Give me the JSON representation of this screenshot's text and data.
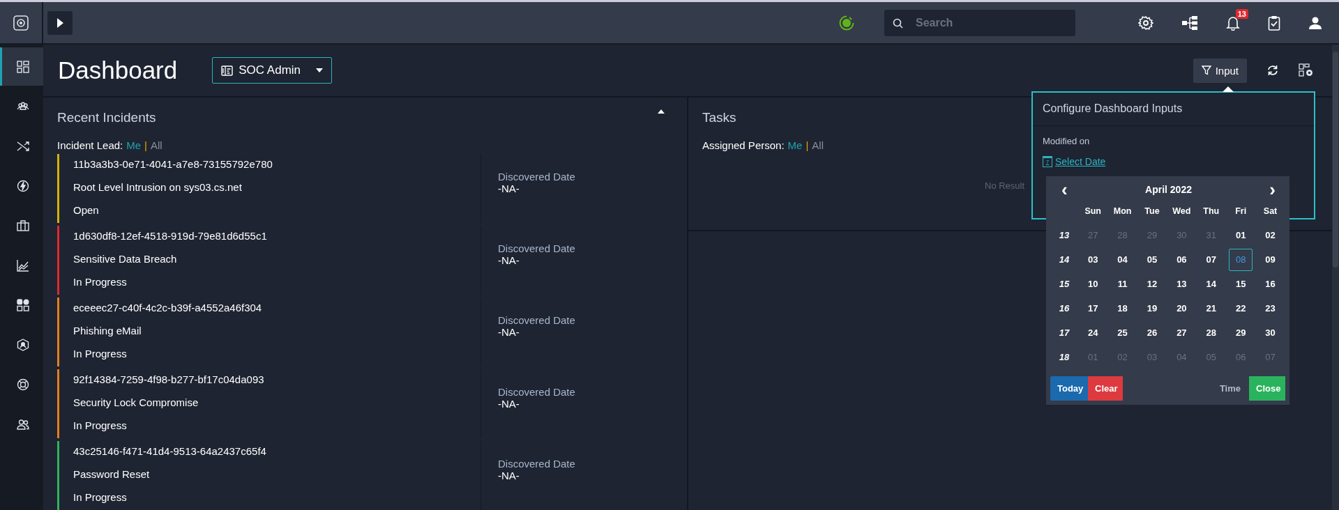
{
  "top_bar": {
    "search": {
      "placeholder": "Search"
    },
    "notifications": {
      "count": "13"
    }
  },
  "sidebar": {
    "items": [
      {
        "selected": true
      },
      {
        "selected": false
      },
      {
        "selected": false
      },
      {
        "selected": false
      },
      {
        "selected": false
      },
      {
        "selected": false
      },
      {
        "selected": false
      },
      {
        "selected": false
      },
      {
        "selected": false
      },
      {
        "selected": false
      }
    ]
  },
  "header": {
    "title": "Dashboard",
    "dashboard_select": "SOC Admin",
    "input_button": "Input"
  },
  "recent_incidents": {
    "title": "Recent Incidents",
    "filter": {
      "label": "Incident Lead:",
      "options": [
        {
          "label": "Me",
          "selected": true
        },
        {
          "label": "All",
          "selected": false
        }
      ],
      "separator": "|"
    },
    "rows": [
      {
        "id": "11b3a3b3-0e71-4041-a7e8-73155792e780",
        "name": "Root Level Intrusion on sys03.cs.net",
        "status": "Open",
        "color": "#d4b106",
        "date_label": "Discovered Date",
        "date": "-NA-"
      },
      {
        "id": "1d630df8-12ef-4518-919d-79e81d6d55c1",
        "name": "Sensitive Data Breach",
        "status": "In Progress",
        "color": "#e0282e",
        "date_label": "Discovered Date",
        "date": "-NA-"
      },
      {
        "id": "eceeec27-c40f-4c2c-b39f-a4552a46f304",
        "name": "Phishing eMail",
        "status": "In Progress",
        "color": "#e57f19",
        "date_label": "Discovered Date",
        "date": "-NA-"
      },
      {
        "id": "92f14384-7259-4f98-b277-bf17c04da093",
        "name": "Security Lock Compromise",
        "status": "In Progress",
        "color": "#e57f19",
        "date_label": "Discovered Date",
        "date": "-NA-"
      },
      {
        "id": "43c25146-f471-41d4-9513-64a2437c65f4",
        "name": "Password Reset",
        "status": "In Progress",
        "color": "#2fb35a",
        "date_label": "Discovered Date",
        "date": "-NA-"
      }
    ]
  },
  "tasks": {
    "title": "Tasks",
    "filter": {
      "label": "Assigned Person:",
      "options": [
        {
          "label": "Me",
          "selected": true
        },
        {
          "label": "All",
          "selected": false
        }
      ],
      "separator": "|"
    },
    "empty_text": "No Result"
  },
  "configure_inputs": {
    "title": "Configure Dashboard Inputs",
    "field_label": "Modified on",
    "select_date": "Select Date",
    "calendar_icon_day": "7",
    "calendar": {
      "month": "April 2022",
      "prev": "‹",
      "next": "›",
      "weekdays": [
        "Sun",
        "Mon",
        "Tue",
        "Wed",
        "Thu",
        "Fri",
        "Sat"
      ],
      "weeks": [
        {
          "number": "13",
          "days": [
            {
              "label": "27",
              "outside_month": true,
              "selected": false
            },
            {
              "label": "28",
              "outside_month": true,
              "selected": false
            },
            {
              "label": "29",
              "outside_month": true,
              "selected": false
            },
            {
              "label": "30",
              "outside_month": true,
              "selected": false
            },
            {
              "label": "31",
              "outside_month": true,
              "selected": false
            },
            {
              "label": "01",
              "outside_month": false,
              "selected": false
            },
            {
              "label": "02",
              "outside_month": false,
              "selected": false
            }
          ]
        },
        {
          "number": "14",
          "days": [
            {
              "label": "03",
              "outside_month": false,
              "selected": false
            },
            {
              "label": "04",
              "outside_month": false,
              "selected": false
            },
            {
              "label": "05",
              "outside_month": false,
              "selected": false
            },
            {
              "label": "06",
              "outside_month": false,
              "selected": false
            },
            {
              "label": "07",
              "outside_month": false,
              "selected": false
            },
            {
              "label": "08",
              "outside_month": false,
              "selected": true
            },
            {
              "label": "09",
              "outside_month": false,
              "selected": false
            }
          ]
        },
        {
          "number": "15",
          "days": [
            {
              "label": "10",
              "outside_month": false,
              "selected": false
            },
            {
              "label": "11",
              "outside_month": false,
              "selected": false
            },
            {
              "label": "12",
              "outside_month": false,
              "selected": false
            },
            {
              "label": "13",
              "outside_month": false,
              "selected": false
            },
            {
              "label": "14",
              "outside_month": false,
              "selected": false
            },
            {
              "label": "15",
              "outside_month": false,
              "selected": false
            },
            {
              "label": "16",
              "outside_month": false,
              "selected": false
            }
          ]
        },
        {
          "number": "16",
          "days": [
            {
              "label": "17",
              "outside_month": false,
              "selected": false
            },
            {
              "label": "18",
              "outside_month": false,
              "selected": false
            },
            {
              "label": "19",
              "outside_month": false,
              "selected": false
            },
            {
              "label": "20",
              "outside_month": false,
              "selected": false
            },
            {
              "label": "21",
              "outside_month": false,
              "selected": false
            },
            {
              "label": "22",
              "outside_month": false,
              "selected": false
            },
            {
              "label": "23",
              "outside_month": false,
              "selected": false
            }
          ]
        },
        {
          "number": "17",
          "days": [
            {
              "label": "24",
              "outside_month": false,
              "selected": false
            },
            {
              "label": "25",
              "outside_month": false,
              "selected": false
            },
            {
              "label": "26",
              "outside_month": false,
              "selected": false
            },
            {
              "label": "27",
              "outside_month": false,
              "selected": false
            },
            {
              "label": "28",
              "outside_month": false,
              "selected": false
            },
            {
              "label": "29",
              "outside_month": false,
              "selected": false
            },
            {
              "label": "30",
              "outside_month": false,
              "selected": false
            }
          ]
        },
        {
          "number": "18",
          "days": [
            {
              "label": "01",
              "outside_month": true,
              "selected": false
            },
            {
              "label": "02",
              "outside_month": true,
              "selected": false
            },
            {
              "label": "03",
              "outside_month": true,
              "selected": false
            },
            {
              "label": "04",
              "outside_month": true,
              "selected": false
            },
            {
              "label": "05",
              "outside_month": true,
              "selected": false
            },
            {
              "label": "06",
              "outside_month": true,
              "selected": false
            },
            {
              "label": "07",
              "outside_month": true,
              "selected": false
            }
          ]
        }
      ],
      "buttons": {
        "today": "Today",
        "clear": "Clear",
        "time": "Time",
        "close": "Close"
      }
    }
  }
}
